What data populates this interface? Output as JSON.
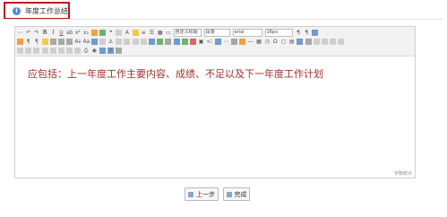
{
  "tab": {
    "title": "年度工作总结",
    "icon": "info-icon"
  },
  "editor": {
    "content": "应包括：上一年度工作主要内容、成绩、不足以及下一年度工作计划",
    "word_count": "字数统计",
    "text_color": "#a0302c",
    "selects": {
      "style": "自定义标题",
      "paragraph": "段落",
      "font": "arial",
      "size": "16px"
    }
  },
  "buttons": {
    "prev": "上一步",
    "done": "完成"
  },
  "colors": {
    "accent_border": "#c0161c",
    "info_icon": "#4a8ad8"
  }
}
